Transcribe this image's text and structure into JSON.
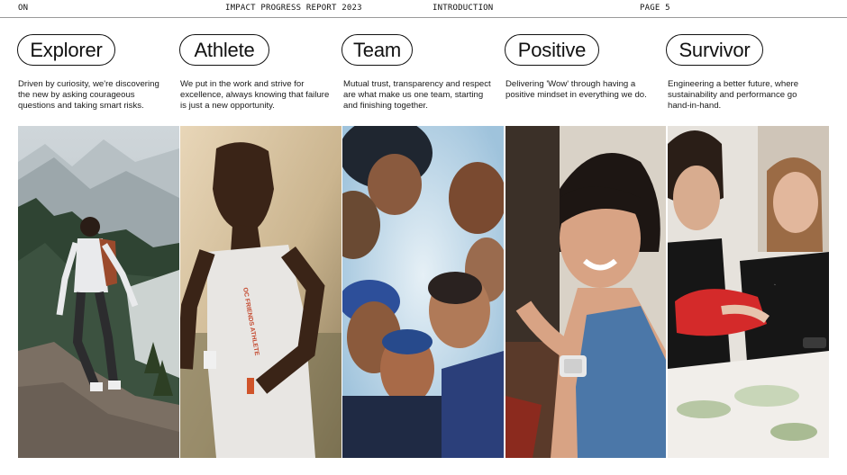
{
  "header": {
    "brand": "ON",
    "report_title": "IMPACT PROGRESS REPORT 2023",
    "section": "INTRODUCTION",
    "page": "PAGE 5"
  },
  "values": [
    {
      "title": "Explorer",
      "description": "Driven by curiosity, we're discovering the new by asking courageous questions and taking smart risks."
    },
    {
      "title": "Athlete",
      "description": "We put in the work and strive for excellence, always knowing that failure is just a new opportunity."
    },
    {
      "title": "Team",
      "description": "Mutual trust, transparency and respect are what make us one team, starting and finishing together."
    },
    {
      "title": "Positive",
      "description": "Delivering 'Wow' through having a positive mindset in everything we do."
    },
    {
      "title": "Survivor",
      "description": "Engineering a better future, where sustainability and performance go hand-in-hand."
    }
  ],
  "photos": {
    "athlete_shirt_text": "OC FRIENDS ATHLETE"
  }
}
